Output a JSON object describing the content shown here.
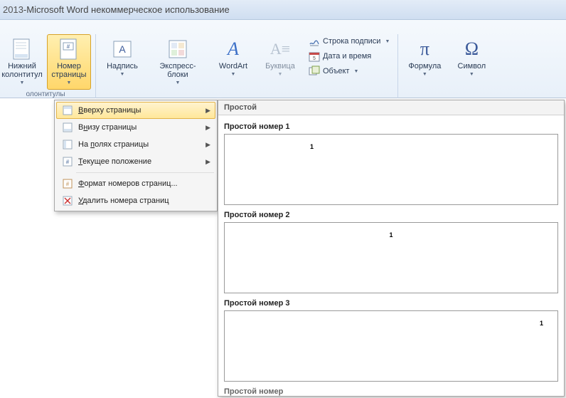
{
  "title": {
    "doc": "2013",
    "app": "Microsoft Word некоммерческое использование",
    "sep": " - "
  },
  "ribbon": {
    "group_footer": {
      "lower_footer": "Нижний\nколонтитул",
      "page_number": "Номер\nстраницы",
      "label": "олонтитулы"
    },
    "group_text": {
      "textbox": "Надпись",
      "quickparts": "Экспресс-блоки",
      "wordart": "WordArt",
      "dropcap": "Буквица",
      "sig_line": "Строка подписи",
      "datetime": "Дата и время",
      "object": "Объект"
    },
    "group_symbols": {
      "equation": "Формула",
      "symbol": "Символ"
    }
  },
  "menu": {
    "items": [
      {
        "label_pre": "",
        "hot": "В",
        "label_post": "верху страницы",
        "has_sub": true,
        "hover": true
      },
      {
        "label_pre": "В",
        "hot": "н",
        "label_post": "изу страницы",
        "has_sub": true
      },
      {
        "label_pre": "На ",
        "hot": "п",
        "label_post": "олях страницы",
        "has_sub": true
      },
      {
        "label_pre": "",
        "hot": "Т",
        "label_post": "екущее положение",
        "has_sub": true
      },
      {
        "sep": true
      },
      {
        "label_pre": "",
        "hot": "Ф",
        "label_post": "ормат номеров страниц...",
        "has_sub": false
      },
      {
        "label_pre": "",
        "hot": "У",
        "label_post": "далить номера страниц",
        "has_sub": false
      }
    ]
  },
  "gallery": {
    "header": "Простой",
    "items": [
      {
        "title": "Простой номер 1",
        "align": "left",
        "num": "1"
      },
      {
        "title": "Простой номер 2",
        "align": "center",
        "num": "1"
      },
      {
        "title": "Простой номер 3",
        "align": "right",
        "num": "1"
      }
    ],
    "next_section": "Простой номер"
  }
}
